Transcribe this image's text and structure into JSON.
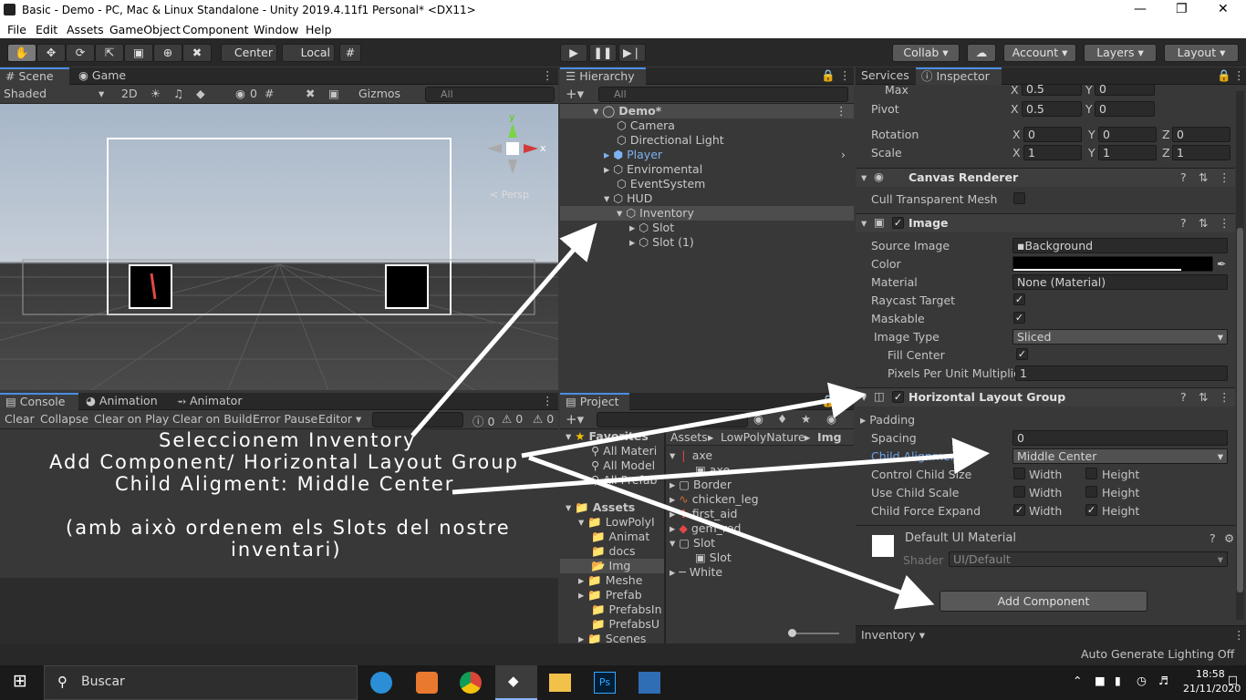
{
  "window": {
    "title": "Basic - Demo - PC, Mac & Linux Standalone - Unity 2019.4.11f1 Personal* <DX11>"
  },
  "menu": [
    "File",
    "Edit",
    "Assets",
    "GameObject",
    "Component",
    "Window",
    "Help"
  ],
  "toolbar": {
    "center": "Center",
    "local": "Local",
    "collab": "Collab",
    "account": "Account",
    "layers": "Layers",
    "layout": "Layout"
  },
  "scene": {
    "tab_scene": "Scene",
    "tab_game": "Game",
    "shaded": "Shaded",
    "two_d": "2D",
    "hidden_count": "0",
    "gizmos": "Gizmos",
    "search_placeholder": "All",
    "persp": "< Persp",
    "axis_x": "x",
    "axis_y": "y"
  },
  "hierarchy": {
    "tab": "Hierarchy",
    "search_placeholder": "All",
    "items": [
      {
        "label": "Demo*",
        "depth": 0
      },
      {
        "label": "Camera",
        "depth": 1
      },
      {
        "label": "Directional Light",
        "depth": 1
      },
      {
        "label": "Player",
        "depth": 1
      },
      {
        "label": "Enviromental",
        "depth": 1
      },
      {
        "label": "EventSystem",
        "depth": 1
      },
      {
        "label": "HUD",
        "depth": 1
      },
      {
        "label": "Inventory",
        "depth": 2
      },
      {
        "label": "Slot",
        "depth": 3
      },
      {
        "label": "Slot (1)",
        "depth": 3
      }
    ]
  },
  "inspector": {
    "tab_services": "Services",
    "tab_inspector": "Inspector",
    "max": {
      "label": "Max",
      "x": "0.5",
      "y": "0"
    },
    "pivot": {
      "label": "Pivot",
      "x": "0.5",
      "y": "0"
    },
    "rotation": {
      "label": "Rotation",
      "x": "0",
      "y": "0",
      "z": "0"
    },
    "scale": {
      "label": "Scale",
      "x": "1",
      "y": "1",
      "z": "1"
    },
    "canvas_renderer": {
      "title": "Canvas Renderer",
      "cull_label": "Cull Transparent Mesh"
    },
    "image": {
      "title": "Image",
      "source_label": "Source Image",
      "source_value": "Background",
      "color_label": "Color",
      "material_label": "Material",
      "material_value": "None (Material)",
      "raycast_label": "Raycast Target",
      "maskable_label": "Maskable",
      "type_label": "Image Type",
      "type_value": "Sliced",
      "fill_label": "Fill Center",
      "ppu_label": "Pixels Per Unit Multiplier",
      "ppu_value": "1"
    },
    "hlg": {
      "title": "Horizontal Layout Group",
      "padding_label": "Padding",
      "spacing_label": "Spacing",
      "spacing_value": "0",
      "child_align_label": "Child Alignment",
      "child_align_value": "Middle Center",
      "ccs_label": "Control Child Size",
      "ucs_label": "Use Child Scale",
      "cfe_label": "Child Force Expand",
      "width": "Width",
      "height": "Height"
    },
    "material": {
      "name": "Default UI Material",
      "shader_label": "Shader",
      "shader_value": "UI/Default"
    },
    "add_component": "Add Component",
    "footer": "Inventory"
  },
  "console": {
    "tab_console": "Console",
    "tab_animation": "Animation",
    "tab_animator": "Animator",
    "buttons": [
      "Clear",
      "Collapse",
      "Clear on Play",
      "Clear on Build",
      "Error Pause",
      "Editor"
    ],
    "counts": [
      "0",
      "0",
      "0"
    ]
  },
  "project": {
    "tab": "Project",
    "favorites": "Favorites",
    "fav_items": [
      "All Materi",
      "All Model",
      "All Prefab"
    ],
    "assets_label": "Assets",
    "tree": [
      "LowPolyI",
      "Animat",
      "docs",
      "Img",
      "Meshe",
      "Prefab",
      "PrefabsIn",
      "PrefabsU",
      "Scenes"
    ],
    "breadcrumb": [
      "Assets",
      "LowPolyNature",
      "Img"
    ],
    "files": [
      "axe",
      "axe",
      "Border",
      "chicken_leg",
      "first_aid",
      "gem_red",
      "Slot",
      "Slot",
      "White"
    ]
  },
  "annotation": {
    "line1": "Seleccionem Inventory",
    "line2": "Add Component/ Horizontal Layout Group",
    "line3": "Child Aligment: Middle Center",
    "line4": "(amb això ordenem els Slots del nostre",
    "line5": "inventari)"
  },
  "status": {
    "lighting": "Auto Generate Lighting Off"
  },
  "taskbar": {
    "search": "Buscar",
    "time": "18:58",
    "date": "21/11/2020"
  }
}
